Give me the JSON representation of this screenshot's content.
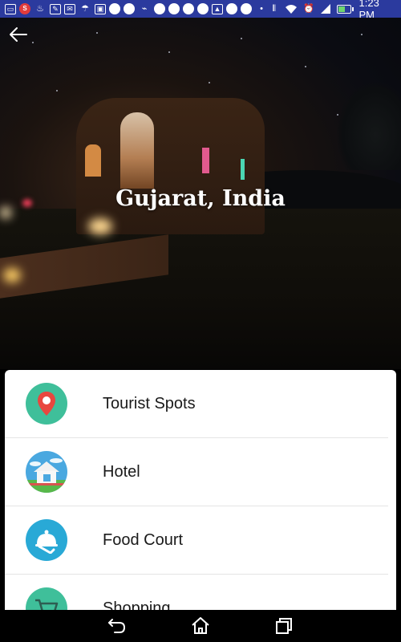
{
  "status_bar": {
    "time": "1:23 PM",
    "battery_level": 0.6,
    "color": "#2b3a9e"
  },
  "header": {
    "back_icon": "back-arrow-icon",
    "title": "Gujarat, India"
  },
  "categories": [
    {
      "label": "Tourist Spots",
      "icon": "map-pin-icon",
      "color": "#3fbf9a"
    },
    {
      "label": "Hotel",
      "icon": "hotel-house-icon",
      "color": "#4aa8e0"
    },
    {
      "label": "Food Court",
      "icon": "food-cloche-icon",
      "color": "#29a9d6"
    },
    {
      "label": "Shopping",
      "icon": "shopping-cart-icon",
      "color": "#3fbf9a"
    }
  ],
  "nav_bar": {
    "back": "nav-back-icon",
    "home": "nav-home-icon",
    "recents": "nav-recents-icon"
  }
}
